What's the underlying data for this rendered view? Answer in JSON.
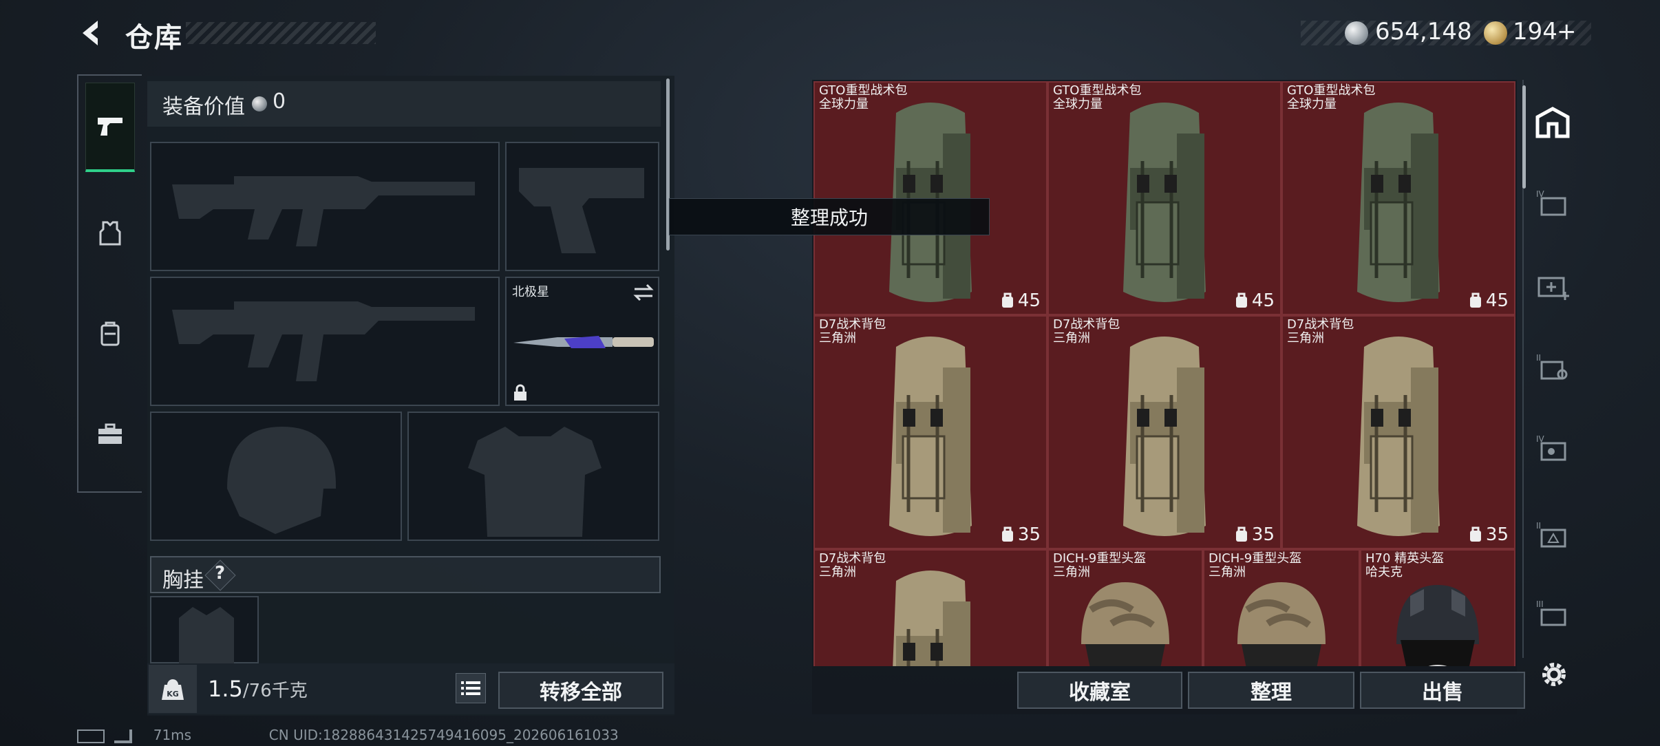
{
  "header": {
    "title": "仓库",
    "silver_amount": "654,148",
    "gold_amount": "194",
    "gold_plus": "+"
  },
  "left": {
    "equip_value_label": "装备价值",
    "equip_value": "0",
    "melee_slot_label": "北极星",
    "chest_label": "胸挂",
    "chest_help": "?",
    "weight_value": "1.5",
    "weight_capacity": "/76千克",
    "kg_badge": "KG",
    "transfer_all": "转移全部"
  },
  "toast": "整理成功",
  "items": [
    {
      "name": "GTO重型战术包",
      "sub": "全球力量",
      "capacity": "45",
      "kind": "backpack-green"
    },
    {
      "name": "GTO重型战术包",
      "sub": "全球力量",
      "capacity": "45",
      "kind": "backpack-green"
    },
    {
      "name": "GTO重型战术包",
      "sub": "全球力量",
      "capacity": "45",
      "kind": "backpack-green"
    },
    {
      "name": "D7战术背包",
      "sub": "三角洲",
      "capacity": "35",
      "kind": "backpack-tan"
    },
    {
      "name": "D7战术背包",
      "sub": "三角洲",
      "capacity": "35",
      "kind": "backpack-tan"
    },
    {
      "name": "D7战术背包",
      "sub": "三角洲",
      "capacity": "35",
      "kind": "backpack-tan"
    },
    {
      "name": "D7战术背包",
      "sub": "三角洲",
      "capacity": "",
      "kind": "backpack-tan"
    },
    {
      "name": "DICH-9重型头盔",
      "sub": "三角洲",
      "capacity": "",
      "kind": "helmet-camo"
    },
    {
      "name": "DICH-9重型头盔",
      "sub": "三角洲",
      "capacity": "",
      "kind": "helmet-camo"
    },
    {
      "name": "H70 精英头盔",
      "sub": "哈夫克",
      "capacity": "",
      "kind": "helmet-black"
    }
  ],
  "bottom_buttons": {
    "collection": "收藏室",
    "organize": "整理",
    "sell": "出售"
  },
  "status": {
    "ping": "71ms",
    "uid": "CN UID:182886431425749416095_202606161033"
  },
  "colors": {
    "accent_green": "#2fd08a",
    "cell_red": "#5a1c20"
  }
}
